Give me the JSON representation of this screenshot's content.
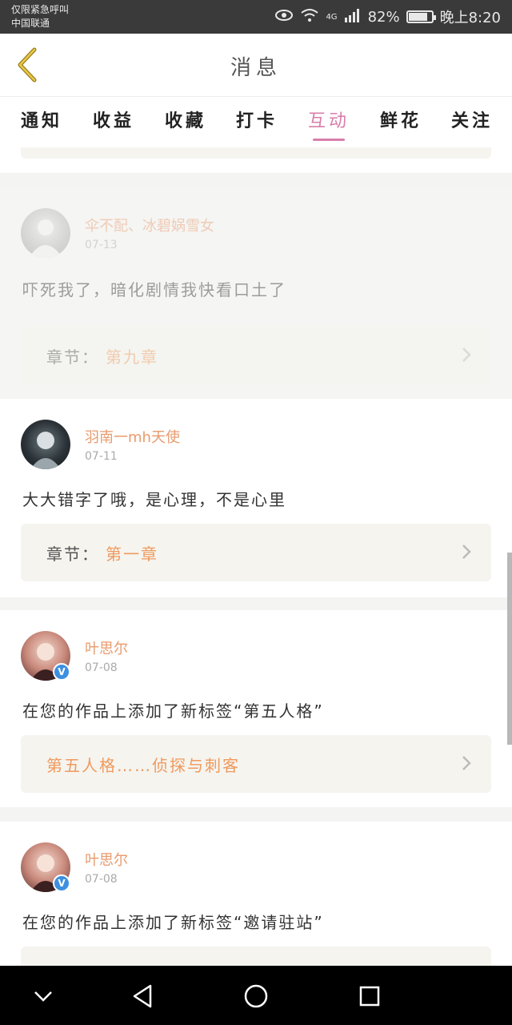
{
  "status_bar": {
    "carrier_line1": "仅限紧急呼叫",
    "carrier_line2": "中国联通",
    "network": "4G",
    "battery_percent": "82%",
    "battery_level": 0.82,
    "time": "晚上8:20",
    "icons": [
      "eye-icon",
      "wifi-icon",
      "signal-icon",
      "battery-icon"
    ]
  },
  "header": {
    "title": "消息",
    "back_icon": "chevron-left-icon"
  },
  "tabs": [
    {
      "label": "通知",
      "active": false
    },
    {
      "label": "收益",
      "active": false
    },
    {
      "label": "收藏",
      "active": false
    },
    {
      "label": "打卡",
      "active": false
    },
    {
      "label": "互动",
      "active": true
    },
    {
      "label": "鲜花",
      "active": false
    },
    {
      "label": "关注",
      "active": false
    }
  ],
  "feed": [
    {
      "username": "伞不配、冰碧娲雪女",
      "date": "07-13",
      "message": "吓死我了，暗化剧情我快看口土了",
      "chapter_label": "章节：",
      "chapter_value": "第九章"
    },
    {
      "username": "羽南一mh天使",
      "date": "07-11",
      "message": "大大错字了哦，是心理，不是心里",
      "chapter_label": "章节：",
      "chapter_value": "第一章"
    },
    {
      "username": "叶思尔",
      "date": "07-08",
      "verified": true,
      "message": "在您的作品上添加了新标签“第五人格”",
      "tag": "第五人格……侦探与刺客"
    },
    {
      "username": "叶思尔",
      "date": "07-08",
      "verified": true,
      "message": "在您的作品上添加了新标签“邀请驻站”"
    }
  ],
  "colors": {
    "accent": "#d77fab",
    "link": "#ef9a5e",
    "username": "#e89b6e"
  },
  "navbar": {
    "icons": [
      "chevron-down-icon",
      "back-triangle-icon",
      "home-circle-icon",
      "recents-square-icon"
    ]
  }
}
